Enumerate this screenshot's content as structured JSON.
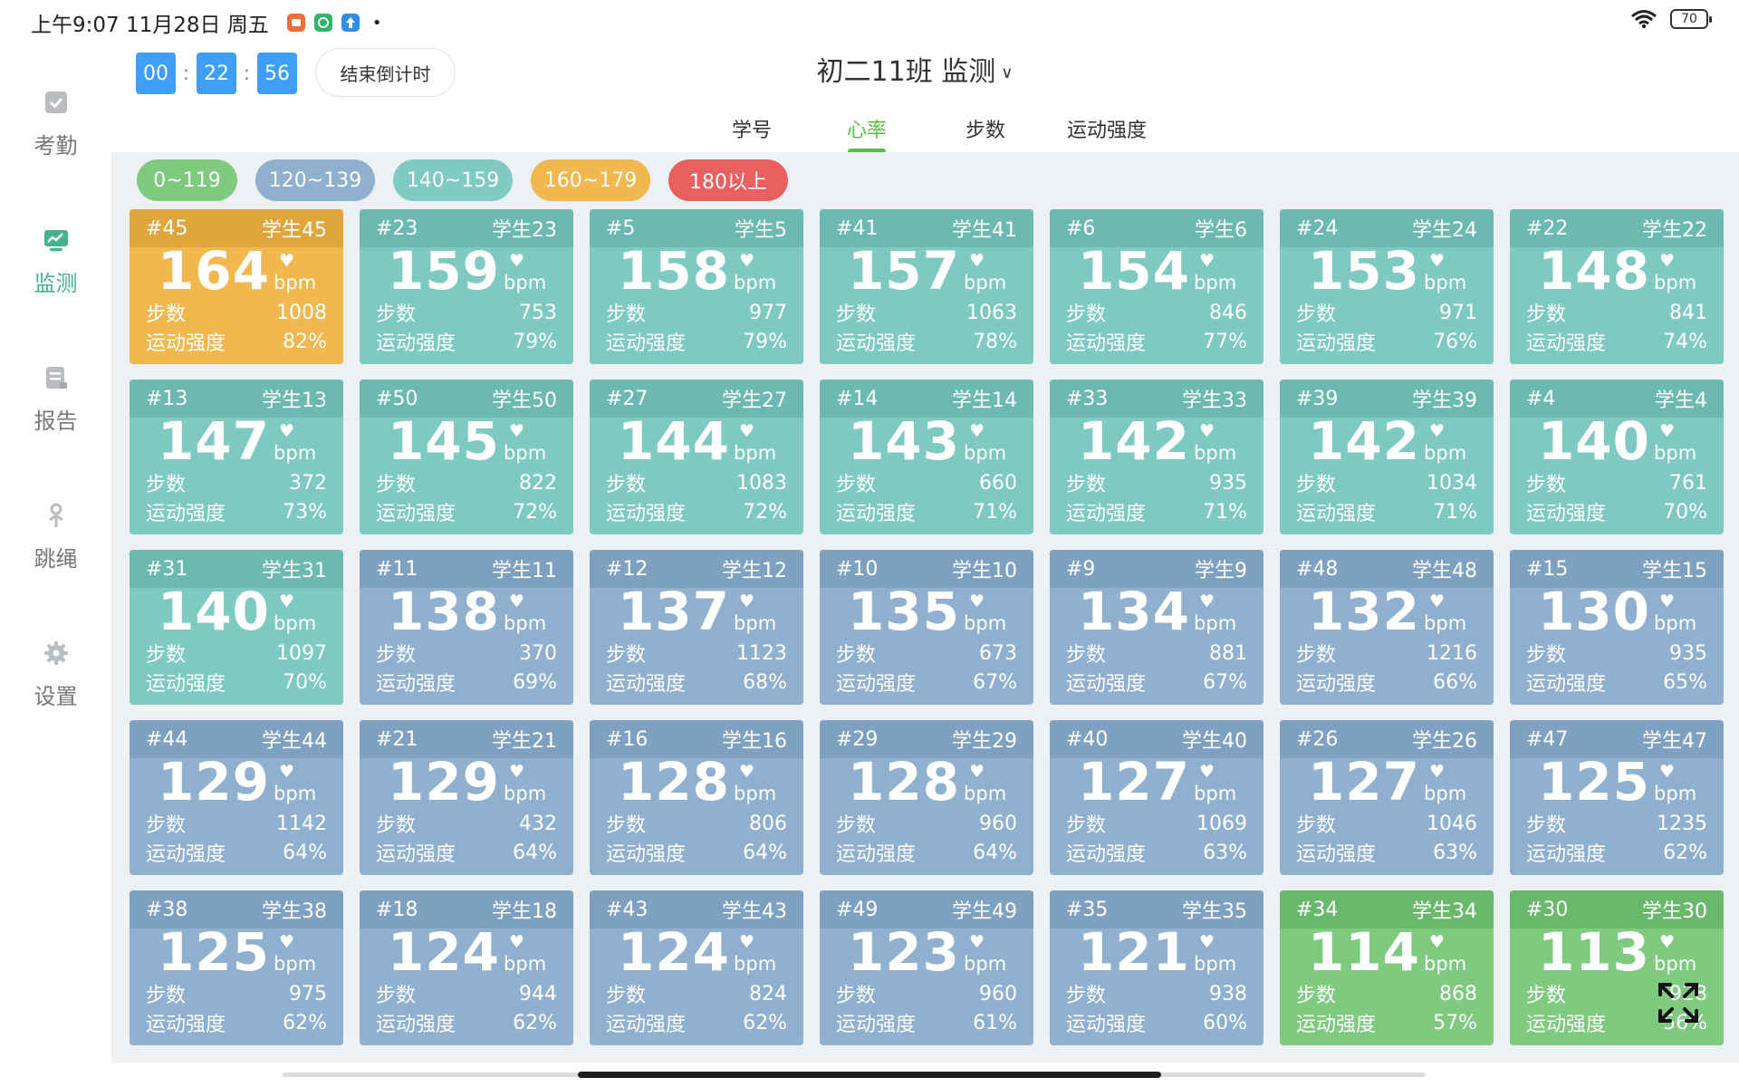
{
  "status_bar": {
    "datetime": "上午9:07 11月28日 周五",
    "battery": "70"
  },
  "sidebar": {
    "items": [
      {
        "label": "考勤",
        "icon": "attendance-icon",
        "active": false
      },
      {
        "label": "监测",
        "icon": "monitor-icon",
        "active": true
      },
      {
        "label": "报告",
        "icon": "report-icon",
        "active": false
      },
      {
        "label": "跳绳",
        "icon": "jump-rope-icon",
        "active": false
      },
      {
        "label": "设置",
        "icon": "gear-icon",
        "active": false
      }
    ]
  },
  "timer": {
    "hours": "00",
    "minutes": "22",
    "seconds": "56",
    "sep": ":"
  },
  "end_button": "结束倒计时",
  "class_title": "初二11班 监测",
  "tabs": [
    {
      "label": "学号",
      "active": false
    },
    {
      "label": "心率",
      "active": true
    },
    {
      "label": "步数",
      "active": false
    },
    {
      "label": "运动强度",
      "active": false
    }
  ],
  "legend": [
    {
      "label": "0~119",
      "color": "#7ecb7f"
    },
    {
      "label": "120~139",
      "color": "#8fb0cf"
    },
    {
      "label": "140~159",
      "color": "#7fcbc4"
    },
    {
      "label": "160~179",
      "color": "#f2b84f"
    },
    {
      "label": "180以上",
      "color": "#e8605f"
    }
  ],
  "labels": {
    "unit": "bpm",
    "steps": "步数",
    "intensity": "运动强度"
  },
  "students": [
    {
      "id": "#45",
      "name": "学生45",
      "hr": "164",
      "steps": "1008",
      "intensity": "82%",
      "zone": "orange"
    },
    {
      "id": "#23",
      "name": "学生23",
      "hr": "159",
      "steps": "753",
      "intensity": "79%",
      "zone": "teal"
    },
    {
      "id": "#5",
      "name": "学生5",
      "hr": "158",
      "steps": "977",
      "intensity": "79%",
      "zone": "teal"
    },
    {
      "id": "#41",
      "name": "学生41",
      "hr": "157",
      "steps": "1063",
      "intensity": "78%",
      "zone": "teal"
    },
    {
      "id": "#6",
      "name": "学生6",
      "hr": "154",
      "steps": "846",
      "intensity": "77%",
      "zone": "teal"
    },
    {
      "id": "#24",
      "name": "学生24",
      "hr": "153",
      "steps": "971",
      "intensity": "76%",
      "zone": "teal"
    },
    {
      "id": "#22",
      "name": "学生22",
      "hr": "148",
      "steps": "841",
      "intensity": "74%",
      "zone": "teal"
    },
    {
      "id": "#13",
      "name": "学生13",
      "hr": "147",
      "steps": "372",
      "intensity": "73%",
      "zone": "teal"
    },
    {
      "id": "#50",
      "name": "学生50",
      "hr": "145",
      "steps": "822",
      "intensity": "72%",
      "zone": "teal"
    },
    {
      "id": "#27",
      "name": "学生27",
      "hr": "144",
      "steps": "1083",
      "intensity": "72%",
      "zone": "teal"
    },
    {
      "id": "#14",
      "name": "学生14",
      "hr": "143",
      "steps": "660",
      "intensity": "71%",
      "zone": "teal"
    },
    {
      "id": "#33",
      "name": "学生33",
      "hr": "142",
      "steps": "935",
      "intensity": "71%",
      "zone": "teal"
    },
    {
      "id": "#39",
      "name": "学生39",
      "hr": "142",
      "steps": "1034",
      "intensity": "71%",
      "zone": "teal"
    },
    {
      "id": "#4",
      "name": "学生4",
      "hr": "140",
      "steps": "761",
      "intensity": "70%",
      "zone": "teal"
    },
    {
      "id": "#31",
      "name": "学生31",
      "hr": "140",
      "steps": "1097",
      "intensity": "70%",
      "zone": "teal"
    },
    {
      "id": "#11",
      "name": "学生11",
      "hr": "138",
      "steps": "370",
      "intensity": "69%",
      "zone": "blue"
    },
    {
      "id": "#12",
      "name": "学生12",
      "hr": "137",
      "steps": "1123",
      "intensity": "68%",
      "zone": "blue"
    },
    {
      "id": "#10",
      "name": "学生10",
      "hr": "135",
      "steps": "673",
      "intensity": "67%",
      "zone": "blue"
    },
    {
      "id": "#9",
      "name": "学生9",
      "hr": "134",
      "steps": "881",
      "intensity": "67%",
      "zone": "blue"
    },
    {
      "id": "#48",
      "name": "学生48",
      "hr": "132",
      "steps": "1216",
      "intensity": "66%",
      "zone": "blue"
    },
    {
      "id": "#15",
      "name": "学生15",
      "hr": "130",
      "steps": "935",
      "intensity": "65%",
      "zone": "blue"
    },
    {
      "id": "#44",
      "name": "学生44",
      "hr": "129",
      "steps": "1142",
      "intensity": "64%",
      "zone": "blue"
    },
    {
      "id": "#21",
      "name": "学生21",
      "hr": "129",
      "steps": "432",
      "intensity": "64%",
      "zone": "blue"
    },
    {
      "id": "#16",
      "name": "学生16",
      "hr": "128",
      "steps": "806",
      "intensity": "64%",
      "zone": "blue"
    },
    {
      "id": "#29",
      "name": "学生29",
      "hr": "128",
      "steps": "960",
      "intensity": "64%",
      "zone": "blue"
    },
    {
      "id": "#40",
      "name": "学生40",
      "hr": "127",
      "steps": "1069",
      "intensity": "63%",
      "zone": "blue"
    },
    {
      "id": "#26",
      "name": "学生26",
      "hr": "127",
      "steps": "1046",
      "intensity": "63%",
      "zone": "blue"
    },
    {
      "id": "#47",
      "name": "学生47",
      "hr": "125",
      "steps": "1235",
      "intensity": "62%",
      "zone": "blue"
    },
    {
      "id": "#38",
      "name": "学生38",
      "hr": "125",
      "steps": "975",
      "intensity": "62%",
      "zone": "blue"
    },
    {
      "id": "#18",
      "name": "学生18",
      "hr": "124",
      "steps": "944",
      "intensity": "62%",
      "zone": "blue"
    },
    {
      "id": "#43",
      "name": "学生43",
      "hr": "124",
      "steps": "824",
      "intensity": "62%",
      "zone": "blue"
    },
    {
      "id": "#49",
      "name": "学生49",
      "hr": "123",
      "steps": "960",
      "intensity": "61%",
      "zone": "blue"
    },
    {
      "id": "#35",
      "name": "学生35",
      "hr": "121",
      "steps": "938",
      "intensity": "60%",
      "zone": "blue"
    },
    {
      "id": "#34",
      "name": "学生34",
      "hr": "114",
      "steps": "868",
      "intensity": "57%",
      "zone": "green"
    },
    {
      "id": "#30",
      "name": "学生30",
      "hr": "113",
      "steps": "928",
      "intensity": "56%",
      "zone": "green"
    }
  ],
  "zone_colors": {
    "orange": {
      "head": "#e0a53c",
      "body": "#f0b84e"
    },
    "teal": {
      "head": "#6cb9b1",
      "body": "#7ecac3"
    },
    "blue": {
      "head": "#7ea0c1",
      "body": "#90b0cf"
    },
    "green": {
      "head": "#6ab86b",
      "body": "#7ecb7f"
    }
  },
  "colors": {
    "accent": "#43b38f",
    "tab_active": "#5bbf45",
    "timer": "#3f9ef7"
  }
}
